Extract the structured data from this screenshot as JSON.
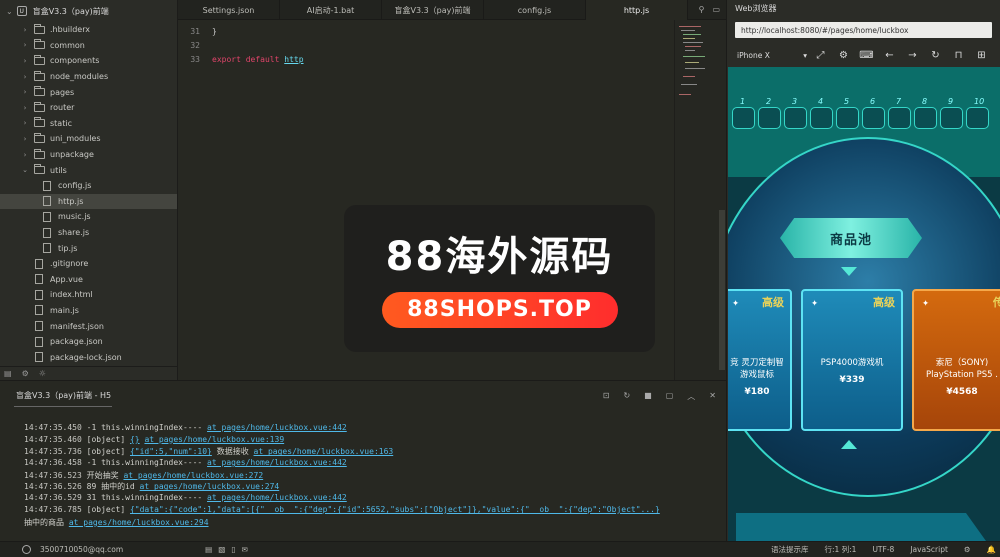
{
  "sidebar": {
    "project_icon": "U",
    "project": "盲盒V3.3（pay)前端",
    "items": [
      {
        "label": ".hbuilderx",
        "type": "folder",
        "indent": 1,
        "expanded": false
      },
      {
        "label": "common",
        "type": "folder",
        "indent": 1,
        "expanded": false
      },
      {
        "label": "components",
        "type": "folder",
        "indent": 1,
        "expanded": false
      },
      {
        "label": "node_modules",
        "type": "folder",
        "indent": 1,
        "expanded": false
      },
      {
        "label": "pages",
        "type": "folder",
        "indent": 1,
        "expanded": false
      },
      {
        "label": "router",
        "type": "folder",
        "indent": 1,
        "expanded": false
      },
      {
        "label": "static",
        "type": "folder",
        "indent": 1,
        "expanded": false
      },
      {
        "label": "uni_modules",
        "type": "folder",
        "indent": 1,
        "expanded": false
      },
      {
        "label": "unpackage",
        "type": "folder",
        "indent": 1,
        "expanded": false
      },
      {
        "label": "utils",
        "type": "folder",
        "indent": 1,
        "expanded": true
      },
      {
        "label": "config.js",
        "type": "file",
        "indent": 2
      },
      {
        "label": "http.js",
        "type": "file",
        "indent": 2,
        "selected": true
      },
      {
        "label": "music.js",
        "type": "file",
        "indent": 2
      },
      {
        "label": "share.js",
        "type": "file",
        "indent": 2
      },
      {
        "label": "tip.js",
        "type": "file",
        "indent": 2
      },
      {
        "label": ".gitignore",
        "type": "file",
        "indent": 1
      },
      {
        "label": "App.vue",
        "type": "file",
        "indent": 1
      },
      {
        "label": "index.html",
        "type": "file",
        "indent": 1
      },
      {
        "label": "main.js",
        "type": "file",
        "indent": 1
      },
      {
        "label": "manifest.json",
        "type": "file",
        "indent": 1
      },
      {
        "label": "package.json",
        "type": "file",
        "indent": 1
      },
      {
        "label": "package-lock.json",
        "type": "file",
        "indent": 1
      }
    ],
    "bottom_icons": [
      "file-tree-icon",
      "settings-icon",
      "debug-icon"
    ]
  },
  "tabs": [
    {
      "label": "Settings.json",
      "active": false
    },
    {
      "label": "AI启动-1.bat",
      "active": false
    },
    {
      "label": "盲盒V3.3（pay)前端",
      "active": false
    },
    {
      "label": "config.js",
      "active": false
    },
    {
      "label": "http.js",
      "active": true
    }
  ],
  "editor": {
    "lines": [
      {
        "num": "31",
        "text": "}"
      },
      {
        "num": "32",
        "text": ""
      },
      {
        "num": "33",
        "kw": "export default",
        "ident": "http"
      }
    ]
  },
  "promo": {
    "title": "88海外源码",
    "pill": "88SHOPS.TOP"
  },
  "console": {
    "title": "盲盒V3.3（pay)前端 - H5",
    "lines": [
      {
        "ts": "14:47:35.450",
        "msg": "-1 this.winningIndex----",
        "link": "at pages/home/luckbox.vue:442"
      },
      {
        "ts": "14:47:35.460",
        "msg": "[object] ",
        "obj": "{}",
        "link": "at pages/home/luckbox.vue:139"
      },
      {
        "ts": "14:47:35.736",
        "msg": "[object] ",
        "obj": "{\"id\":5,\"num\":10}",
        "msg2": "数据接收",
        "link": "at pages/home/luckbox.vue:163"
      },
      {
        "ts": "14:47:36.458",
        "msg": "-1 this.winningIndex----",
        "link": "at pages/home/luckbox.vue:442"
      },
      {
        "ts": "14:47:36.523",
        "msg": "开始抽奖",
        "link": "at pages/home/luckbox.vue:272"
      },
      {
        "ts": "14:47:36.526",
        "msg": "89 抽中的id",
        "link": "at pages/home/luckbox.vue:274"
      },
      {
        "ts": "14:47:36.529",
        "msg": "31 this.winningIndex----",
        "link": "at pages/home/luckbox.vue:442"
      },
      {
        "ts": "14:47:36.785",
        "msg": "[object] ",
        "obj": "{\"data\":{\"code\":1,\"data\":[{\"__ob__\":{\"dep\":{\"id\":5652,\"subs\":[\"Object\"]},\"value\":{\"__ob__\":{\"dep\":\"Object\"...}",
        "link": ""
      },
      {
        "ts": "",
        "msg": " 抽中的商品",
        "link": "at pages/home/luckbox.vue:294"
      }
    ]
  },
  "browser": {
    "tab": "Web浏览器",
    "url": "http://localhost:8080/#/pages/home/luckbox",
    "device": "iPhone X",
    "numbers": [
      "1",
      "2",
      "3",
      "4",
      "5",
      "6",
      "7",
      "8",
      "9",
      "10"
    ],
    "pool_label": "商品池",
    "cards": [
      {
        "tier": "高级",
        "name_l1": "竞 灵刀定制智",
        "name_l2": "游戏鼠标",
        "price": "¥180"
      },
      {
        "tier": "高级",
        "name_l1": "PSP4000游戏机",
        "name_l2": "",
        "price": "¥339"
      },
      {
        "tier": "传",
        "name_l1": "索尼（SONY)",
        "name_l2": "PlayStation PS5 .",
        "price": "¥4568"
      }
    ]
  },
  "statusbar": {
    "user": "3500710050@qq.com",
    "hint": "语法提示库",
    "position": "行:1  列:1",
    "encoding": "UTF-8",
    "language": "JavaScript"
  },
  "colors": {
    "editor_bg": "#272822",
    "keyword": "#e0446a",
    "link": "#4fb8e8",
    "promo_gradient_start": "#ff5a1f",
    "promo_gradient_end": "#ff2d2d",
    "phone_teal": "#35d6c8"
  }
}
